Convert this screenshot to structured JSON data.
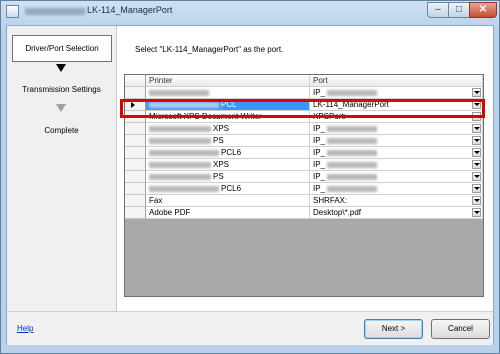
{
  "window": {
    "title": "LK-114_ManagerPort",
    "controls": {
      "minimize": "–",
      "maximize": "□",
      "close": "✕"
    }
  },
  "steps": [
    {
      "label": "Driver/Port Selection",
      "active": true
    },
    {
      "label": "Transmission Settings",
      "active": false
    },
    {
      "label": "Complete",
      "active": false
    }
  ],
  "instruction": "Select \"LK-114_ManagerPort\" as the port.",
  "grid": {
    "headers": {
      "printer": "Printer",
      "port": "Port"
    },
    "rows": [
      {
        "printer": "",
        "port": "IP_"
      },
      {
        "printer": "PCL",
        "port": "LK-114_ManagerPort"
      },
      {
        "printer": "Microsoft XPS Document Writer",
        "port": "XPSPort:"
      },
      {
        "printer": "XPS",
        "port": "IP_"
      },
      {
        "printer": "PS",
        "port": "IP_"
      },
      {
        "printer": "PCL6",
        "port": "IP_"
      },
      {
        "printer": "XPS",
        "port": "IP_"
      },
      {
        "printer": "PS",
        "port": "IP_"
      },
      {
        "printer": "PCL6",
        "port": "IP_"
      },
      {
        "printer": "Fax",
        "port": "SHRFAX:"
      },
      {
        "printer": "Adobe PDF",
        "port": "Desktop\\*.pdf"
      }
    ],
    "selected_row": 1
  },
  "footer": {
    "help": "Help",
    "next": "Next >",
    "cancel": "Cancel"
  },
  "colors": {
    "selection": "#3399ff",
    "highlight": "#e00000",
    "link": "#0033cc"
  },
  "icons": [
    "app-icon",
    "step-arrow-icon",
    "row-selector-icon",
    "dropdown-arrow-icon"
  ]
}
